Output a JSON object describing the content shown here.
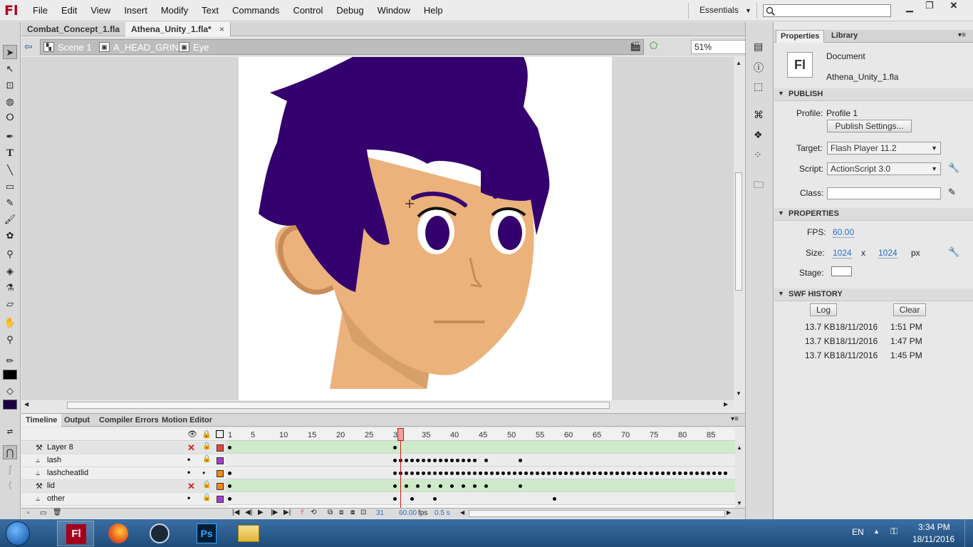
{
  "app": {
    "logo": "Fl",
    "menu": [
      "File",
      "Edit",
      "View",
      "Insert",
      "Modify",
      "Text",
      "Commands",
      "Control",
      "Debug",
      "Window",
      "Help"
    ],
    "workspace": "Essentials"
  },
  "tabs": [
    {
      "label": "Combat_Concept_1.fla",
      "close": "×"
    },
    {
      "label": "Athena_Unity_1.fla*",
      "close": "×"
    }
  ],
  "breadcrumb": {
    "scene": "Scene 1",
    "symbol1": "A_HEAD_GRIN",
    "symbol2": "Eye"
  },
  "zoom": "51%",
  "timeline": {
    "tabs": [
      "Timeline",
      "Output",
      "Compiler Errors",
      "Motion Editor"
    ],
    "ruler": [
      "1",
      "5",
      "10",
      "15",
      "20",
      "25",
      "30",
      "35",
      "40",
      "45",
      "50",
      "55",
      "60",
      "65",
      "70",
      "75",
      "80",
      "85"
    ],
    "current_frame": "31",
    "fps": "60.00",
    "fps_unit": "fps",
    "time": "0.5 s",
    "layers": [
      {
        "name": "Layer 8",
        "hidden": true,
        "color": "#e84646"
      },
      {
        "name": "lash",
        "hidden": false,
        "color": "#a23fc9"
      },
      {
        "name": "lashcheatlid",
        "hidden": false,
        "color": "#f08a1a"
      },
      {
        "name": "lid",
        "hidden": true,
        "color": "#f08a1a"
      },
      {
        "name": "other",
        "hidden": false,
        "color": "#a23fc9"
      }
    ]
  },
  "properties": {
    "tabs": [
      "Properties",
      "Library"
    ],
    "doc_icon": "Fl",
    "doc_type": "Document",
    "doc_name": "Athena_Unity_1.fla",
    "publish": {
      "header": "PUBLISH",
      "profile_label": "Profile:",
      "profile": "Profile 1",
      "settings_button": "Publish Settings...",
      "target_label": "Target:",
      "target": "Flash Player 11.2",
      "script_label": "Script:",
      "script": "ActionScript 3.0",
      "class_label": "Class:",
      "class_value": ""
    },
    "props": {
      "header": "PROPERTIES",
      "fps_label": "FPS:",
      "fps": "60.00",
      "size_label": "Size:",
      "width": "1024",
      "x": "x",
      "height": "1024",
      "unit": "px",
      "stage_label": "Stage:",
      "stage_color": "#ffffff"
    },
    "swf_history": {
      "header": "SWF HISTORY",
      "log_button": "Log",
      "clear_button": "Clear",
      "entries": [
        {
          "size": "13.7 KB",
          "date": "18/11/2016",
          "time": "1:51 PM"
        },
        {
          "size": "13.7 KB",
          "date": "18/11/2016",
          "time": "1:47 PM"
        },
        {
          "size": "13.7 KB",
          "date": "18/11/2016",
          "time": "1:45 PM"
        }
      ]
    }
  },
  "taskbar": {
    "lang": "EN",
    "time": "3:34 PM",
    "date": "18/11/2016",
    "apps": [
      "start-orb",
      "flash-icon",
      "firefox-icon",
      "steam-icon",
      "photoshop-icon",
      "folder-icon"
    ]
  },
  "colors": {
    "hair": "#33006e",
    "skin": "#ecb27c",
    "skin_shadow": "#d7a06a",
    "ear_outline": "#c88c58",
    "accent_red": "#d01c1c"
  }
}
